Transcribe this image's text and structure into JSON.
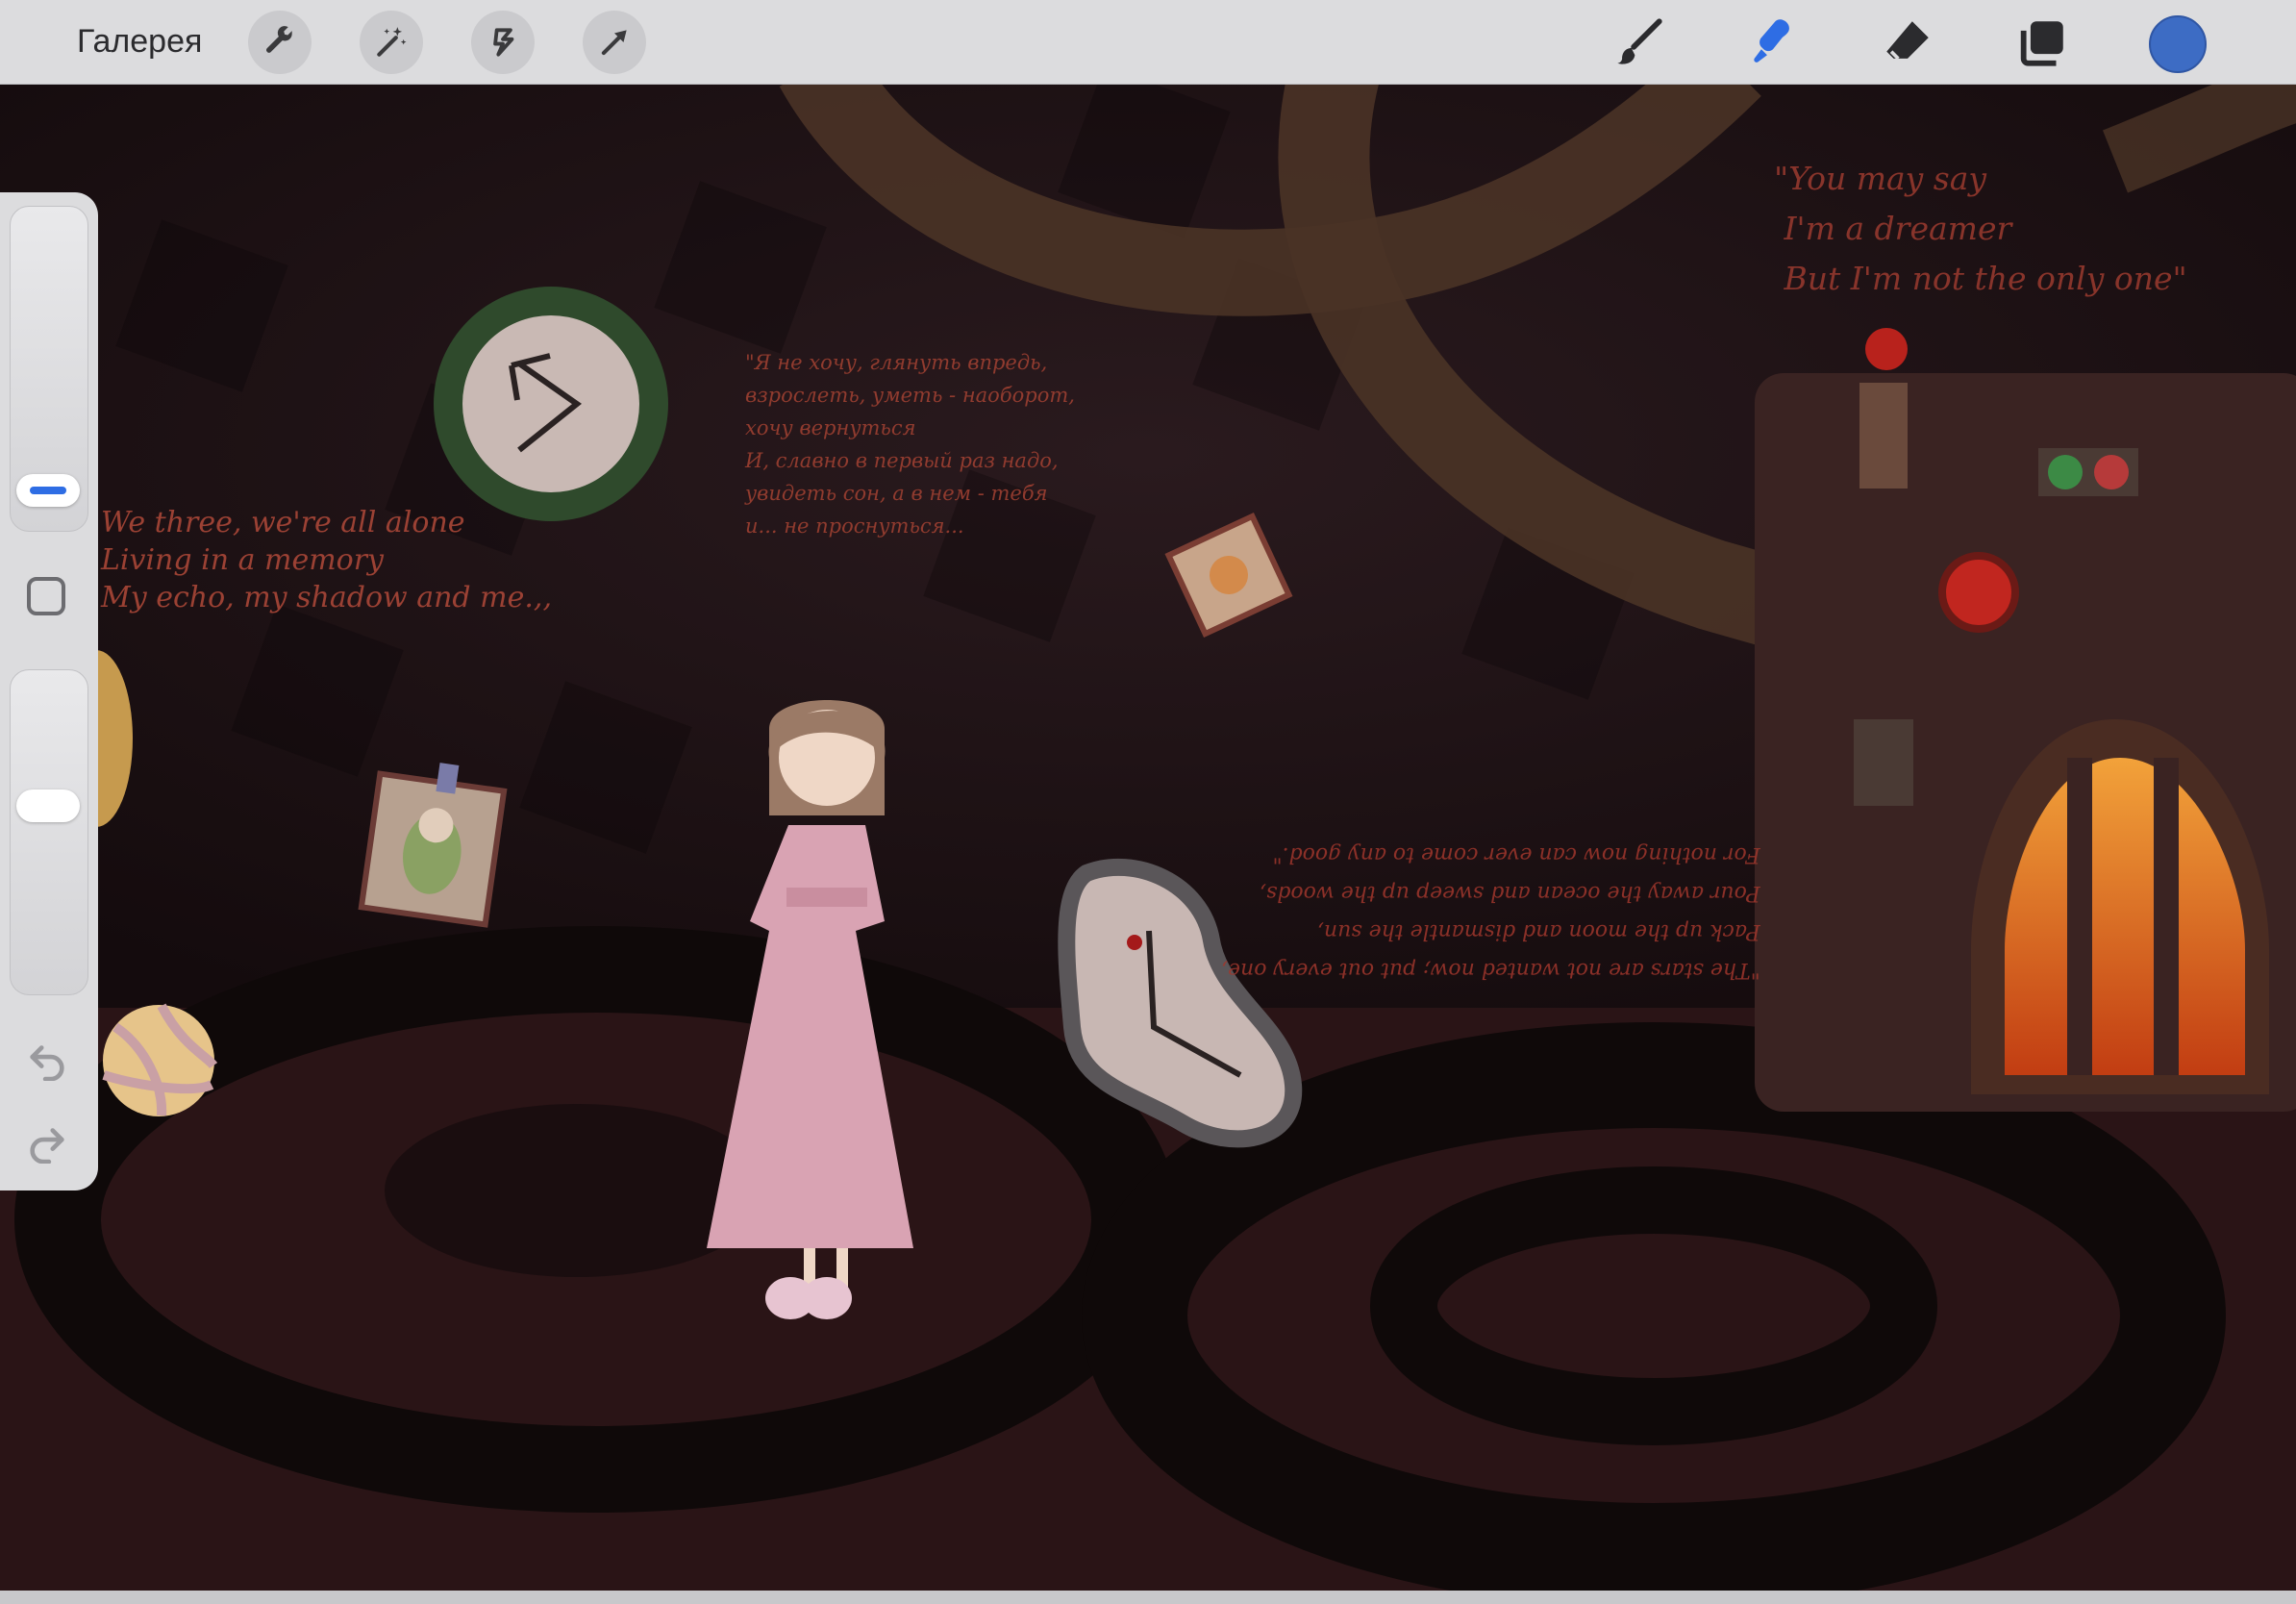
{
  "toolbar": {
    "gallery_label": "Галерея",
    "left_tools": [
      "wrench-icon",
      "magic-wand-icon",
      "selection-icon",
      "transform-arrow-icon"
    ],
    "right_tools": [
      "brush-icon",
      "smudge-icon",
      "eraser-icon",
      "layers-icon"
    ],
    "active_tool": "smudge-icon",
    "active_color": "#3d6cc4",
    "accent_color": "#2e6de4"
  },
  "sidebar": {
    "brush_size_slider": "brush-size",
    "brush_opacity_slider": "brush-opacity",
    "modify_button": "modify-square",
    "undo": "undo-icon",
    "redo": "redo-icon"
  },
  "canvas": {
    "lyrics_left": "We three, we're all alone\nLiving in a memory\nMy echo, my shadow and me.,,",
    "lyrics_right": "\"You may say\n I'm a dreamer\n But I'm not the only one\"",
    "lyrics_ru": "\"Я не хочу, глянуть впредь,\nвзрослеть, уметь - наоборот,\nхочу вернуться\nИ, славно в первый раз надо,\nувидеть сон, а в нем - тебя\nи... не проснуться...",
    "lyrics_mirrored": "\"The stars are not wanted now; put out every one,\nPack up the moon and dismantle the sun,\nPour away the ocean and sweep up the woods,\nFor nothing now can ever come to any good.\""
  }
}
